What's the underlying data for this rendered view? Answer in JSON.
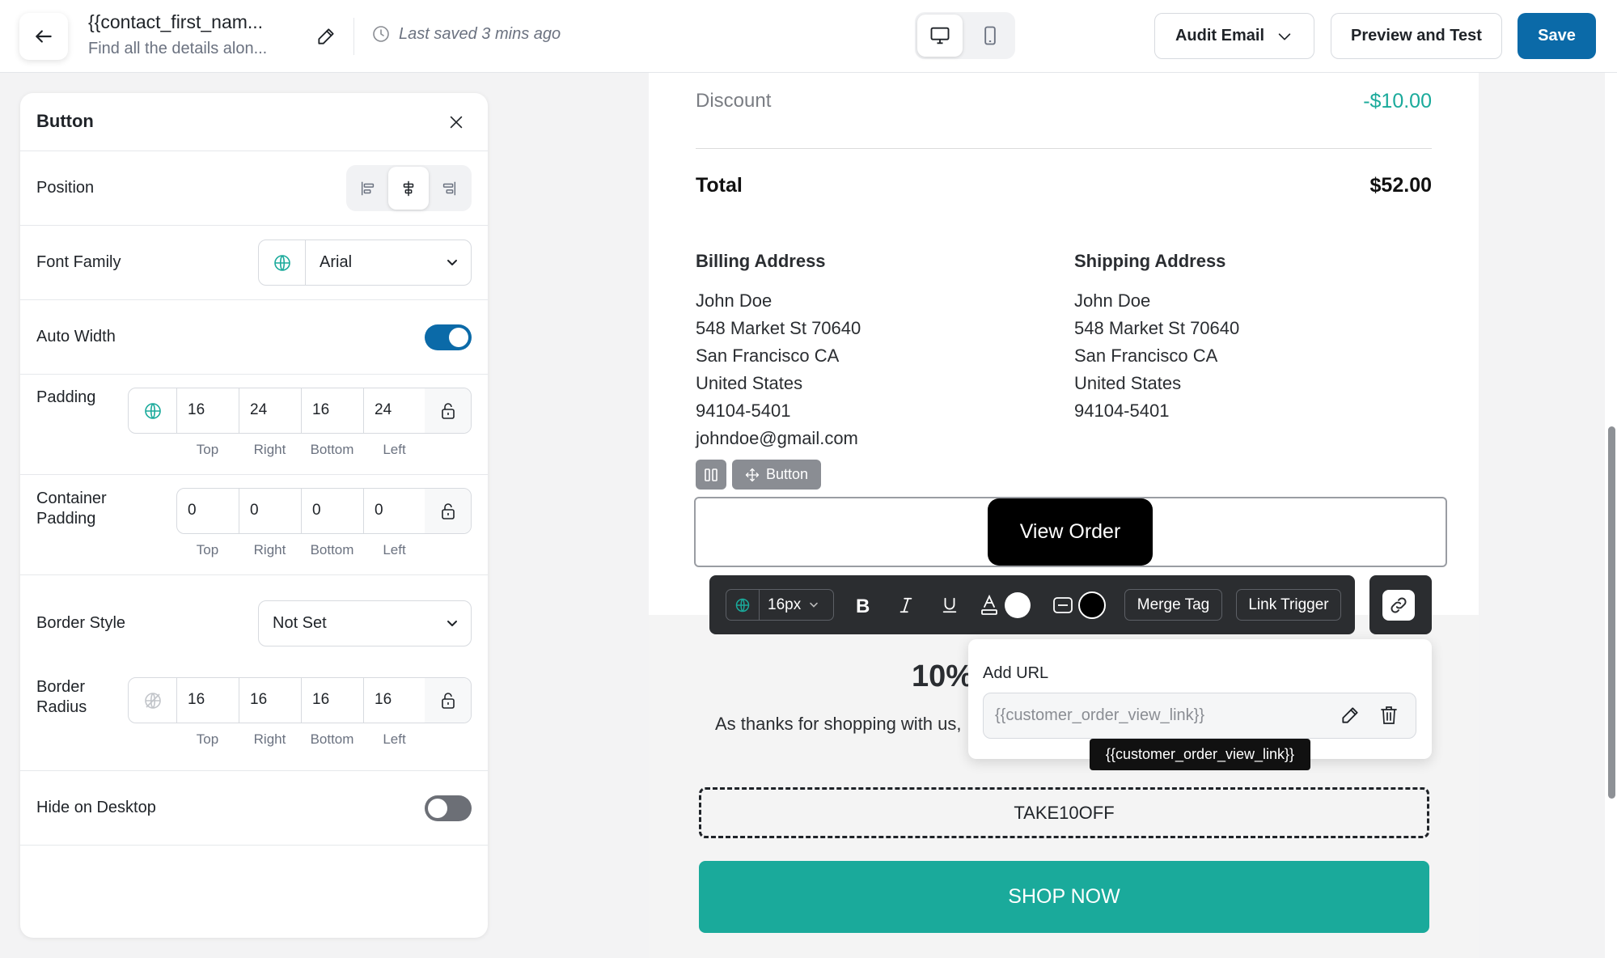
{
  "header": {
    "title": "{{contact_first_nam...",
    "subtitle": "Find all the details alon...",
    "saved_text": "Last saved 3 mins ago",
    "audit_label": "Audit Email",
    "preview_label": "Preview and Test",
    "save_label": "Save",
    "accent_color": "#0b6aa8"
  },
  "panel": {
    "title": "Button",
    "position": {
      "label": "Position",
      "options": [
        "align-left",
        "align-center",
        "align-right"
      ],
      "selected": "align-center"
    },
    "font_family": {
      "label": "Font Family",
      "value": "Arial"
    },
    "auto_width": {
      "label": "Auto Width",
      "on": true
    },
    "padding": {
      "label": "Padding",
      "top": "16",
      "right": "24",
      "bottom": "16",
      "left": "24"
    },
    "container_padding": {
      "label_line1": "Container",
      "label_line2": "Padding",
      "top": "0",
      "right": "0",
      "bottom": "0",
      "left": "0"
    },
    "border_style": {
      "label": "Border Style",
      "value": "Not Set"
    },
    "border_radius": {
      "label_line1": "Border",
      "label_line2": "Radius",
      "top": "16",
      "right": "16",
      "bottom": "16",
      "left": "16"
    },
    "hide_desktop": {
      "label": "Hide on Desktop",
      "on": false
    },
    "side_labels": {
      "top": "Top",
      "right": "Right",
      "bottom": "Bottom",
      "left": "Left"
    }
  },
  "email": {
    "discount_label": "Discount",
    "discount_value": "-$10.00",
    "total_label": "Total",
    "total_value": "$52.00",
    "billing": {
      "heading": "Billing Address",
      "lines": [
        "John Doe",
        "548 Market St 70640",
        "San Francisco CA",
        "United States",
        "94104-5401",
        "johndoe@gmail.com"
      ]
    },
    "shipping": {
      "heading": "Shipping Address",
      "lines": [
        "John Doe",
        "548 Market St 70640",
        "San Francisco CA",
        "United States",
        "94104-5401"
      ]
    },
    "block_tag": "Button",
    "button_text": "View Order",
    "promo_heading": "10%",
    "promo_text": "As thanks for shopping with us,",
    "coupon_code": "TAKE10OFF",
    "shop_label": "SHOP NOW",
    "teal_color": "#1aaa9b"
  },
  "toolbar": {
    "font_size": "16px",
    "merge_tag": "Merge Tag",
    "link_trigger": "Link Trigger"
  },
  "url_popup": {
    "title": "Add URL",
    "value": "{{customer_order_view_link}}",
    "tooltip": "{{customer_order_view_link}}"
  }
}
